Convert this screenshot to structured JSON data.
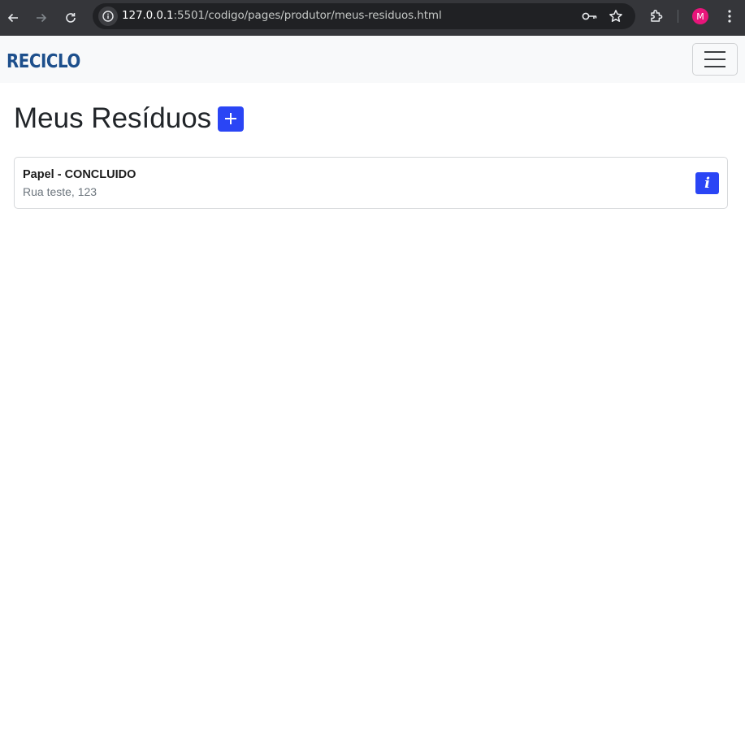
{
  "browser": {
    "url_host": "127.0.0.1",
    "url_path": ":5501/codigo/pages/produtor/meus-residuos.html",
    "profile_initial": "M",
    "profile_color": "#e8157a"
  },
  "navbar": {
    "brand": "RECICLO",
    "brand_color": "#1d4f8c"
  },
  "main": {
    "title": "Meus Resíduos",
    "add_icon": "plus-icon",
    "accent_color": "#2a45f5"
  },
  "residuos": [
    {
      "title": "Papel - CONCLUIDO",
      "address": "Rua teste, 123",
      "info_label": "i"
    }
  ]
}
